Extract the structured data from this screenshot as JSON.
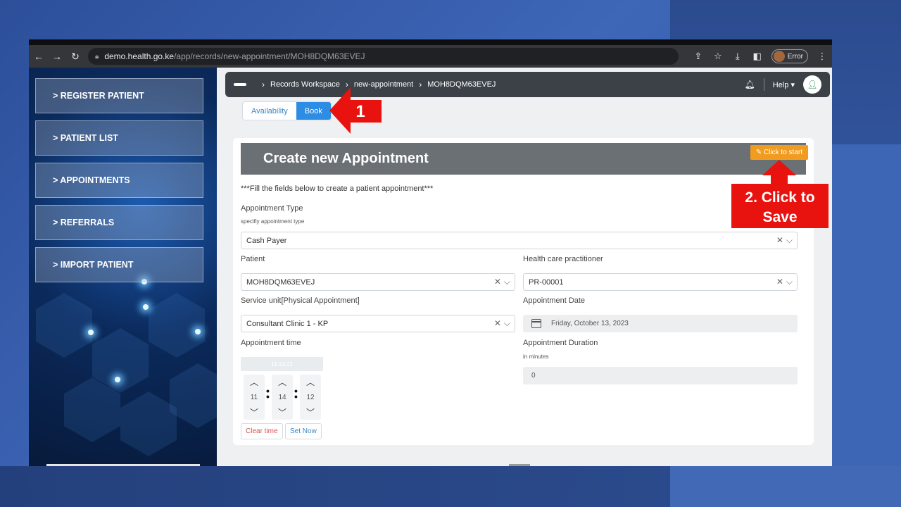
{
  "browser": {
    "url_host": "demo.health.go.ke",
    "url_path": "/app/records/new-appointment/MOH8DQM63EVEJ",
    "profile_status": "Error"
  },
  "sidebar": {
    "items": [
      {
        "label": "> REGISTER PATIENT"
      },
      {
        "label": "> PATIENT LIST"
      },
      {
        "label": "> APPOINTMENTS"
      },
      {
        "label": "> REFERRALS"
      },
      {
        "label": "> IMPORT PATIENT"
      }
    ]
  },
  "topbar": {
    "breadcrumb": [
      "Records Workspace",
      "new-appointment",
      "MOH8DQM63EVEJ"
    ],
    "help_label": "Help"
  },
  "tabs": {
    "availability": "Availability",
    "book": "Book"
  },
  "form": {
    "title": "Create new Appointment",
    "start_button": "Click to start",
    "instructions": "***Fill the fields below to create a patient appointment***",
    "appointment_type": {
      "label": "Appointment Type",
      "help": "specifiy appointment type",
      "value": "Cash Payer"
    },
    "patient": {
      "label": "Patient",
      "value": "MOH8DQM63EVEJ"
    },
    "practitioner": {
      "label": "Health care practitioner",
      "value": "PR-00001"
    },
    "service_unit": {
      "label": "Service unit[Physical Appointment]",
      "value": "Consultant Clinic 1 - KP"
    },
    "appointment_date": {
      "label": "Appointment Date",
      "value": "Friday, October 13, 2023"
    },
    "appointment_time": {
      "label": "Appointment time",
      "display": "11:14:12",
      "hour": "11",
      "minute": "14",
      "second": "12",
      "clear_label": "Clear time",
      "setnow_label": "Set Now"
    },
    "duration": {
      "label": "Appointment Duration",
      "help": "in minutes",
      "value": "0"
    }
  },
  "annotations": {
    "step1": "1",
    "step2_line1": "2. Click to",
    "step2_line2": "Save"
  },
  "colors": {
    "accent_blue": "#2d8ce3",
    "start_orange": "#f29c1f",
    "annotation_red": "#e8120f"
  }
}
